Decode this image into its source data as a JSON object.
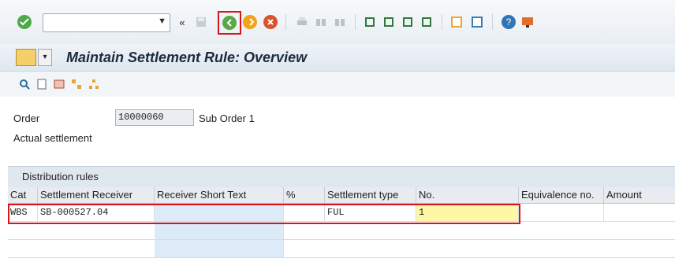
{
  "toolbar": {
    "command_field_value": "",
    "icons": [
      "enter-icon",
      "back-icon",
      "exit-icon",
      "cancel-icon",
      "print-icon",
      "find-icon",
      "find-next-icon",
      "first-page-icon",
      "previous-page-icon",
      "next-page-icon",
      "last-page-icon",
      "new-session-icon",
      "shortcut-icon",
      "help-icon",
      "customize-layout-icon"
    ],
    "highlighted_button": "back-button"
  },
  "header": {
    "title": "Maintain Settlement Rule: Overview"
  },
  "form": {
    "order_label": "Order",
    "order_value": "10000060",
    "order_description": "Sub Order 1",
    "actual_settlement_label": "Actual settlement"
  },
  "distribution": {
    "section_title": "Distribution rules",
    "columns": [
      "Cat",
      "Settlement Receiver",
      "Receiver Short Text",
      "%",
      "Settlement type",
      "No.",
      "Equivalence no.",
      "Amount"
    ],
    "rows": [
      {
        "cat": "WBS",
        "receiver": "SB-000527.04",
        "short_text": "",
        "percent": "",
        "type": "FUL",
        "no": "1",
        "equivalence": "",
        "amount": ""
      }
    ]
  },
  "colors": {
    "highlight_red": "#d8141d",
    "input_yellow": "#fff7a8",
    "column_blue": "#dcebf7"
  }
}
